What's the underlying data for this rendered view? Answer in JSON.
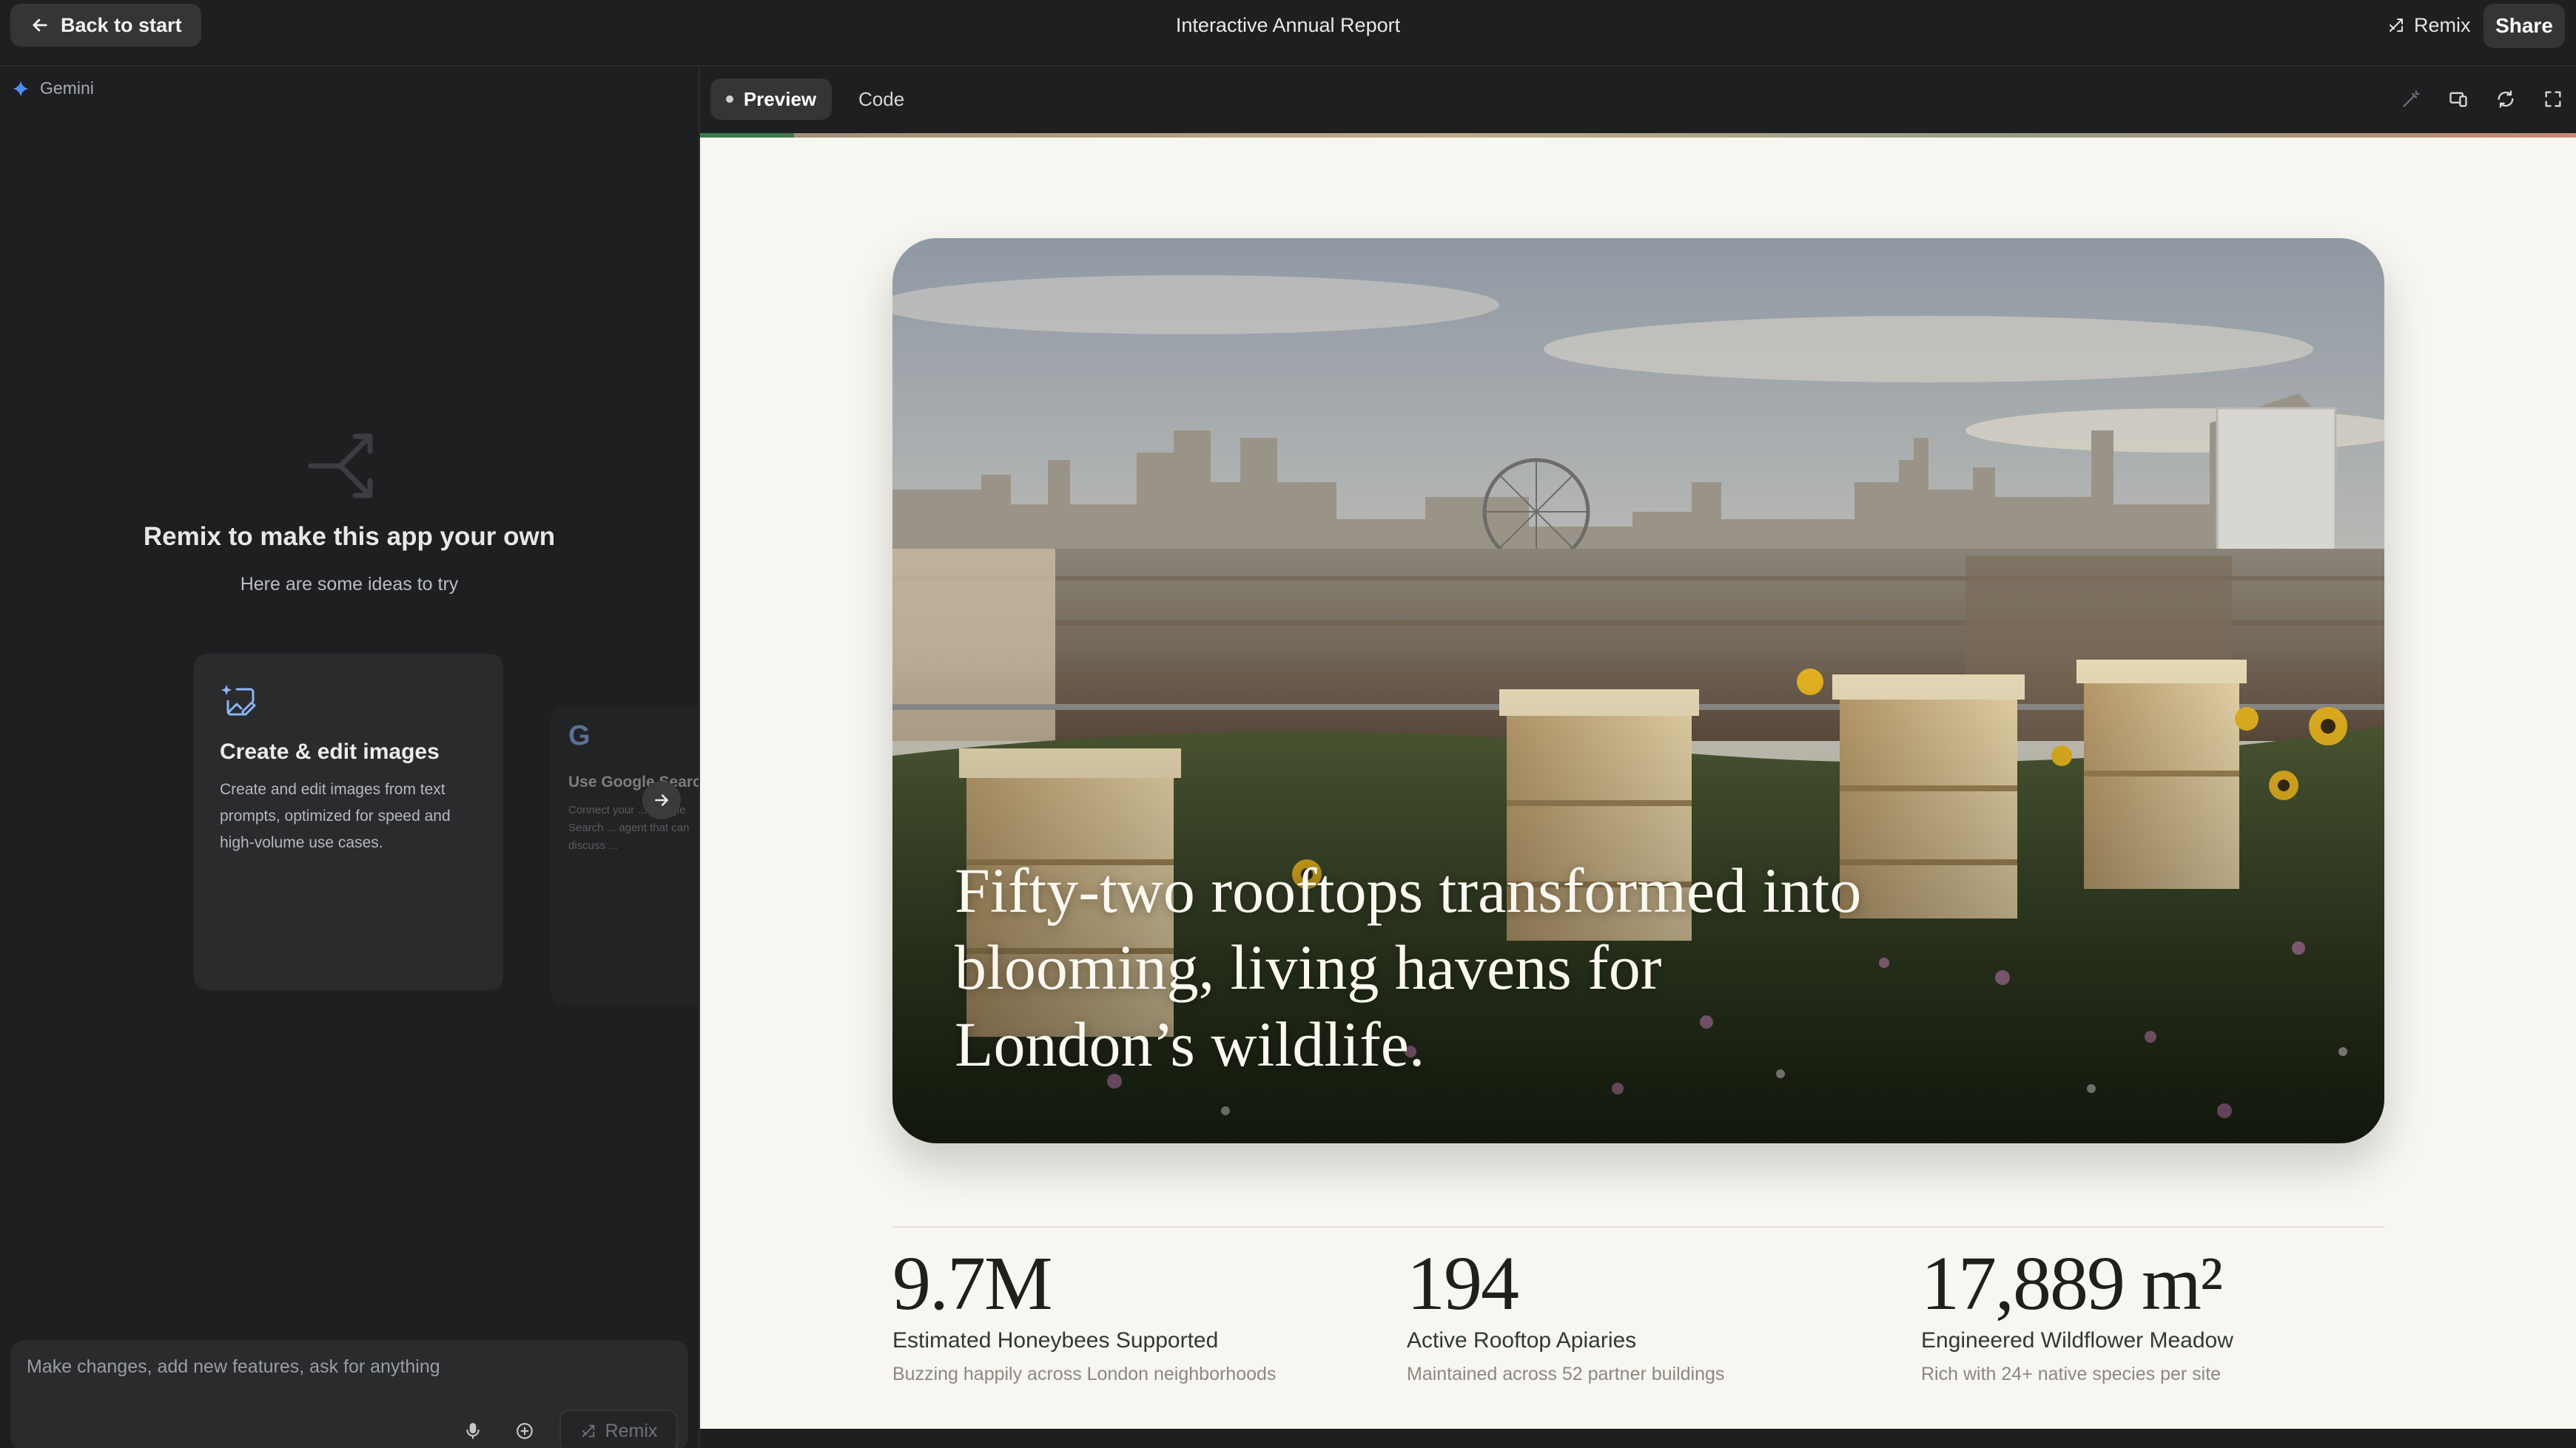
{
  "topbar": {
    "back_label": "Back to start",
    "title": "Interactive Annual Report",
    "remix_label": "Remix",
    "share_label": "Share"
  },
  "left_panel": {
    "model_label": "Gemini",
    "heading": "Remix to make this app your own",
    "subheading": "Here are some ideas to try",
    "ideas": [
      {
        "icon": "image-edit-icon",
        "title": "Create & edit images",
        "description": "Create and edit images from text prompts, optimized for speed and high-volume use cases."
      },
      {
        "icon": "google-g-icon",
        "title": "Use Google Search",
        "description": "Connect your ... Google Search ... agent that can discuss ..."
      }
    ],
    "prompt": {
      "placeholder": "Make changes, add new features, ask for anything",
      "send_label": "Remix"
    }
  },
  "right_panel": {
    "tabs": [
      {
        "label": "Preview",
        "active": true
      },
      {
        "label": "Code",
        "active": false
      }
    ],
    "toolbar_icons": [
      "magic-edit-icon",
      "device-toggle-icon",
      "refresh-icon",
      "fullscreen-icon"
    ]
  },
  "preview": {
    "scroll_progress": 0.05,
    "hero_headline": "Fifty-two rooftops transformed into blooming, living havens for London’s wildlife.",
    "stats": [
      {
        "value": "9.7M",
        "label": "Estimated Honeybees Supported",
        "sub": "Buzzing happily across London neighborhoods"
      },
      {
        "value": "194",
        "label": "Active Rooftop Apiaries",
        "sub": "Maintained across 52 partner buildings"
      },
      {
        "value": "17,889 m²",
        "label": "Engineered Wildflower Meadow",
        "sub": "Rich with 24+ native species per site"
      }
    ]
  },
  "colors": {
    "app_bg": "#1e1f20",
    "card_bg": "#2a2b2d",
    "preview_bg": "#f7f6f1",
    "accent_blue": "#8ab4f8",
    "progress_green": "#3d7a4a"
  }
}
